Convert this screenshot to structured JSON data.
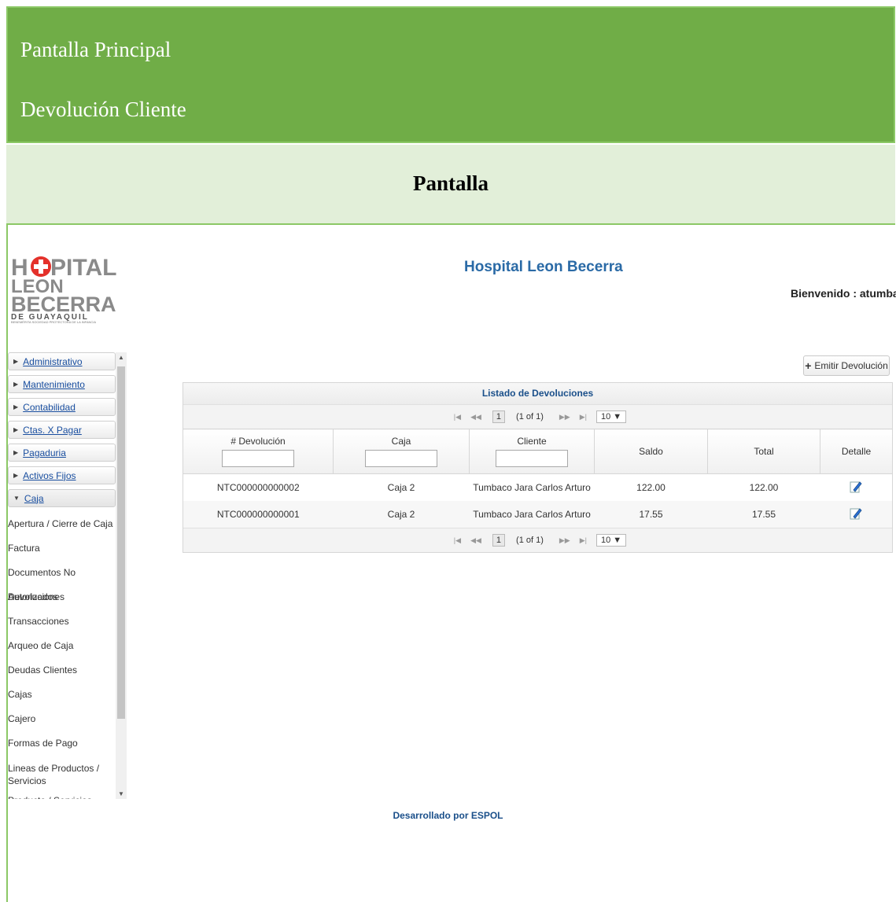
{
  "doc": {
    "heading1": "Pantalla Principal",
    "heading2": "Devolución Cliente",
    "section": "Pantalla"
  },
  "app": {
    "title": "Hospital Leon Becerra",
    "welcome": "Bienvenido : atumbac",
    "logo": {
      "line1": "H SPITAL",
      "line2": "LEON",
      "line3": "BECERRA",
      "line4": "DE GUAYAQUIL",
      "line5": "BENEMÉRITA SOCIEDAD PROTECTORA DE LA INFANCIA"
    },
    "footer": "Desarrollado por ESPOL"
  },
  "menu": {
    "sections": [
      {
        "label": "Administrativo"
      },
      {
        "label": "Mantenimiento"
      },
      {
        "label": "Contabilidad"
      },
      {
        "label": "Ctas. X Pagar"
      },
      {
        "label": "Pagaduria"
      },
      {
        "label": "Activos Fijos"
      },
      {
        "label": "Caja"
      }
    ],
    "caja_items": [
      "Apertura / Cierre de Caja",
      "Factura",
      "Documentos No Autorizados",
      "Devoluciones",
      "Transacciones",
      "Arqueo de Caja",
      "Deudas Clientes",
      "Cajas",
      "Cajero",
      "Formas de Pago",
      "Lineas de Productos / Servicios",
      "Producto / Servicios"
    ]
  },
  "toolbar": {
    "emit_label": "Emitir Devolución"
  },
  "table": {
    "title": "Listado de Devoluciones",
    "pager": {
      "first": "|◀",
      "prev": "◀◀",
      "page": "1",
      "info": "(1 of 1)",
      "next": "▶▶",
      "last": "▶|",
      "rows_per_page": "10 ▼"
    },
    "columns": [
      "# Devolución",
      "Caja",
      "Cliente",
      "Saldo",
      "Total",
      "Detalle"
    ],
    "rows": [
      {
        "num": "NTC000000000002",
        "caja": "Caja 2",
        "cliente": "Tumbaco Jara Carlos Arturo",
        "saldo": "122.00",
        "total": "122.00"
      },
      {
        "num": "NTC000000000001",
        "caja": "Caja 2",
        "cliente": "Tumbaco Jara Carlos Arturo",
        "saldo": "17.55",
        "total": "17.55"
      }
    ]
  },
  "colors": {
    "green": "#70ad47",
    "light_green": "#e2efd9",
    "link_blue": "#1a4fa0",
    "title_blue": "#2a6aa6"
  }
}
